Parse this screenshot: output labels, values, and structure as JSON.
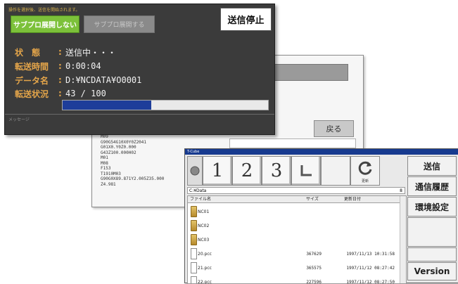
{
  "background_window": {
    "back_label": "戻る",
    "code_lines": [
      "M09",
      "G90G54G10X0Y0Z2041",
      "G01X0.Y0Z0.000",
      "G43Z100.000H02",
      "M01",
      "M08",
      "F153",
      "T1910M03",
      "G90G0X89.871Y2.005Z35.000",
      "Z4.981"
    ]
  },
  "transfer_dialog": {
    "instruction": "操作を選択後、送信を開始されます。",
    "subprog_on_label": "サブプロ展開しない",
    "subprog_off_label": "サブプロ展開する",
    "stop_label": "送信停止",
    "status_label": "状　態",
    "status_value": "送信中・・・",
    "time_label": "転送時間",
    "time_value": "0:00:04",
    "dataname_label": "データ名",
    "dataname_value": "D:¥NCDATA¥O0001",
    "progress_label": "転送状況",
    "progress_value": "43 / 100",
    "progress_current": 43,
    "progress_total": 100,
    "message_label": "メッセージ",
    "colors": {
      "green": "#7cc13a",
      "orange": "#e4a54a",
      "progress": "#1e3d9a",
      "panel": "#3b3b3b"
    }
  },
  "file_manager": {
    "title": "T-Cube",
    "toolbar": {
      "btn1": "1",
      "btn2": "2",
      "btn3": "3",
      "up_icon": "folder-up-icon",
      "refresh_icon": "refresh-icon",
      "refresh_label": "更新"
    },
    "path": "C:¥Data",
    "path_level": "8",
    "columns": {
      "name": "ファイル名",
      "size": "サイズ",
      "date": "更新日付"
    },
    "rows": [
      {
        "type": "folder",
        "name": "NC01",
        "size": "",
        "date": ""
      },
      {
        "type": "folder",
        "name": "NC02",
        "size": "",
        "date": ""
      },
      {
        "type": "folder",
        "name": "NC03",
        "size": "",
        "date": ""
      },
      {
        "type": "file",
        "name": "20.pcc",
        "size": "367629",
        "date": "1997/11/13  10:31:58"
      },
      {
        "type": "file",
        "name": "21.pcc",
        "size": "365575",
        "date": "1997/11/12  08:27:42"
      },
      {
        "type": "file",
        "name": "22.pcc",
        "size": "227596",
        "date": "1997/11/12  08:27:50"
      }
    ],
    "side_buttons": {
      "send": "送信",
      "history": "通信履歴",
      "settings": "環境設定",
      "version": "Version"
    }
  }
}
